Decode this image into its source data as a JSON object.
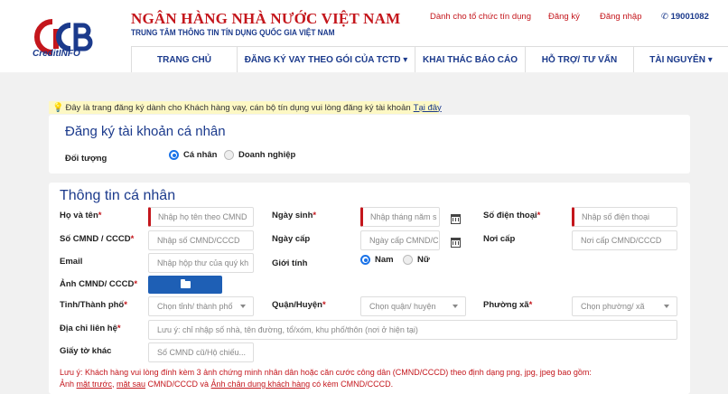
{
  "header": {
    "logo_text": "CreditINFO",
    "title": "NGÂN HÀNG NHÀ NƯỚC VIỆT NAM",
    "subtitle": "TRUNG TÂM THÔNG TIN TÍN DỤNG QUỐC GIA VIỆT NAM",
    "links": [
      "Dành cho tổ chức tín dụng",
      "Đăng ký",
      "Đăng nhập"
    ],
    "phone": "19001082",
    "nav": [
      "TRANG CHỦ",
      "ĐĂNG KÝ VAY THEO GÓI CỦA TCTD ▾",
      "KHAI THÁC BÁO CÁO",
      "HỖ TRỢ/ TƯ VẤN",
      "TÀI NGUYÊN ▾"
    ]
  },
  "notice": {
    "text": "Đây là trang đăng ký dành cho Khách hàng vay, cán bộ tín dụng vui lòng đăng ký tài khoản",
    "link": "Tại đây"
  },
  "account": {
    "title": "Đăng ký tài khoản cá nhân",
    "subject_label": "Đối tượng",
    "options": [
      "Cá nhân",
      "Doanh nghiệp"
    ],
    "selected": "Cá nhân"
  },
  "personal": {
    "title": "Thông tin cá nhân",
    "fields": {
      "fullname": {
        "label": "Họ và tên",
        "placeholder": "Nhập họ tên theo CMND"
      },
      "dob": {
        "label": "Ngày sinh",
        "placeholder": "Nhập tháng năm s"
      },
      "phone": {
        "label": "Số điện thoại",
        "placeholder": "Nhập số điện thoại"
      },
      "idnum": {
        "label": "Số CMND / CCCD",
        "placeholder": "Nhập số CMND/CCCD"
      },
      "issue_date": {
        "label": "Ngày cấp",
        "placeholder": "Ngày cấp CMND/C"
      },
      "issue_place": {
        "label": "Nơi cấp",
        "placeholder": "Nơi cấp CMND/CCCD"
      },
      "email": {
        "label": "Email",
        "placeholder": "Nhập hộp thư của quý kh"
      },
      "gender": {
        "label": "Giới tính",
        "options": [
          "Nam",
          "Nữ"
        ],
        "selected": "Nam"
      },
      "id_image": {
        "label": "Ảnh CMND/ CCCD"
      },
      "province": {
        "label": "Tỉnh/Thành phố",
        "placeholder": "Chọn tỉnh/ thành phố"
      },
      "district": {
        "label": "Quận/Huyện",
        "placeholder": "Chọn quận/ huyện"
      },
      "ward": {
        "label": "Phường xã",
        "placeholder": "Chọn phường/ xã"
      },
      "address": {
        "label": "Địa chỉ liên hệ",
        "placeholder": "Lưu ý: chỉ nhập số nhà, tên đường, tổ/xóm, khu phố/thôn (nơi ở hiện tại)"
      },
      "other_doc": {
        "label": "Giấy tờ khác",
        "placeholder": "Số CMND cũ/Hộ chiếu..."
      }
    },
    "note": {
      "line1": "Lưu ý: Khách hàng vui lòng đính kèm 3 ảnh chứng minh nhân dân hoặc căn cước công dân (CMND/CCCD) theo định dạng png, jpg, jpeg bao gồm:",
      "l2_a": "Ảnh",
      "l2_b": "mặt trước",
      "l2_c": ",",
      "l2_d": "mặt sau",
      "l2_e": "CMND/CCCD và",
      "l2_f": "Ảnh chân dung khách hàng",
      "l2_g": "có kèm CMND/CCCD."
    }
  },
  "colors": {
    "brand_red": "#c4161c",
    "brand_blue": "#1b3a8c",
    "button_blue": "#1e5fb5",
    "notice_bg": "#fdf8c4"
  }
}
